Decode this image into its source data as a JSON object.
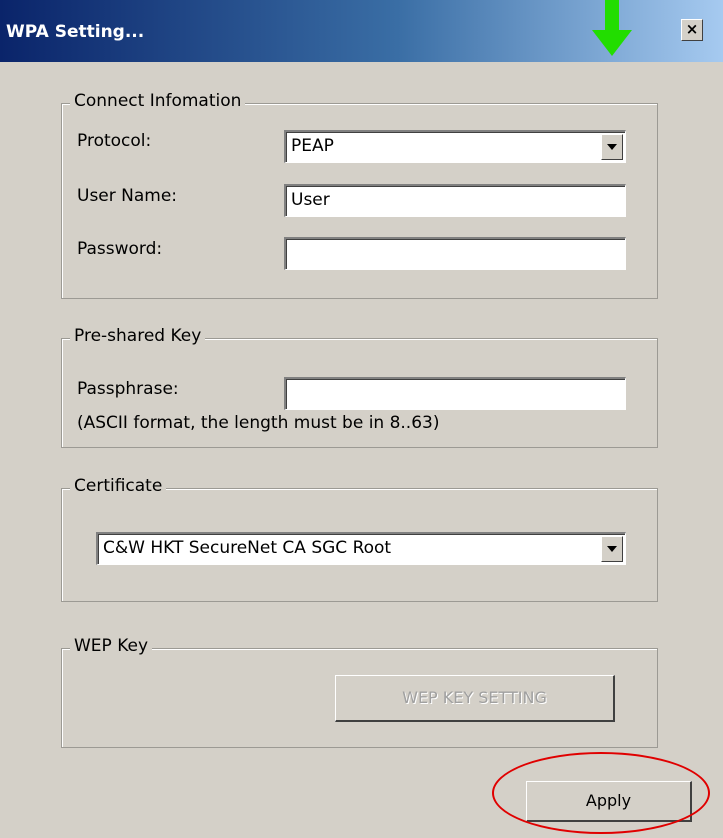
{
  "window": {
    "title": "WPA Setting...",
    "close_label": "×"
  },
  "connect_info": {
    "legend": "Connect Infomation",
    "protocol_label": "Protocol:",
    "protocol_value": "PEAP",
    "username_label": "User Name:",
    "username_value": "User",
    "password_label": "Password:",
    "password_value": ""
  },
  "preshared": {
    "legend": "Pre-shared Key",
    "passphrase_label": "Passphrase:",
    "passphrase_value": "",
    "hint": "(ASCII format, the length must be in 8..63)"
  },
  "certificate": {
    "legend": "Certificate",
    "selected": "C&W HKT SecureNet CA SGC Root"
  },
  "wep": {
    "legend": "WEP Key",
    "button_label": "WEP KEY SETTING"
  },
  "footer": {
    "apply_label": "Apply"
  },
  "colors": {
    "highlight_arrow": "#22dd00",
    "highlight_oval": "#e00000",
    "dialog_bg": "#d4d0c8"
  }
}
